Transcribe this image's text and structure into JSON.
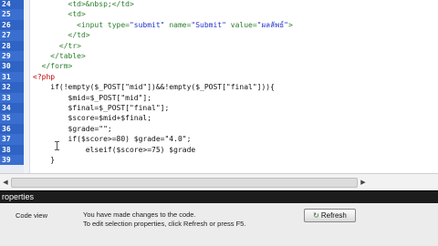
{
  "code_lines": [
    {
      "num": "24",
      "parts": [
        {
          "c": "tag",
          "t": "        <td>&nbsp;</td>"
        }
      ]
    },
    {
      "num": "25",
      "parts": [
        {
          "c": "tag",
          "t": "        <td>"
        }
      ]
    },
    {
      "num": "26",
      "parts": [
        {
          "c": "tag",
          "t": "          <input type="
        },
        {
          "c": "str",
          "t": "\"submit\""
        },
        {
          "c": "tag",
          "t": " name="
        },
        {
          "c": "str",
          "t": "\"Submit\""
        },
        {
          "c": "tag",
          "t": " value="
        },
        {
          "c": "str",
          "t": "\"ผลลัพธ์\""
        },
        {
          "c": "tag",
          "t": ">"
        }
      ]
    },
    {
      "num": "27",
      "parts": [
        {
          "c": "tag",
          "t": "        </td>"
        }
      ]
    },
    {
      "num": "28",
      "parts": [
        {
          "c": "tag",
          "t": "      </tr>"
        }
      ]
    },
    {
      "num": "29",
      "parts": [
        {
          "c": "tag",
          "t": "    </table>"
        }
      ]
    },
    {
      "num": "30",
      "parts": [
        {
          "c": "tag",
          "t": "  </form>"
        }
      ]
    },
    {
      "num": "31",
      "parts": [
        {
          "c": "php",
          "t": "<?php"
        }
      ]
    },
    {
      "num": "32",
      "parts": [
        {
          "c": "plain",
          "t": "    if(!empty($_POST[\"mid\"])&&!empty($_POST[\"final\"])){"
        }
      ]
    },
    {
      "num": "33",
      "parts": [
        {
          "c": "plain",
          "t": "        $mid=$_POST[\"mid\"];"
        }
      ]
    },
    {
      "num": "34",
      "parts": [
        {
          "c": "plain",
          "t": "        $final=$_POST[\"final\"];"
        }
      ]
    },
    {
      "num": "35",
      "parts": [
        {
          "c": "plain",
          "t": "        $score=$mid+$final;"
        }
      ]
    },
    {
      "num": "36",
      "parts": [
        {
          "c": "plain",
          "t": "        $grade=\"\";"
        }
      ]
    },
    {
      "num": "37",
      "parts": [
        {
          "c": "plain",
          "t": "        if($score>=80) $grade=\"4.0\";"
        }
      ]
    },
    {
      "num": "38",
      "parts": [
        {
          "c": "plain",
          "t": "            elseif($score>=75) $grade"
        }
      ]
    },
    {
      "num": "39",
      "parts": [
        {
          "c": "plain",
          "t": "    }"
        }
      ]
    }
  ],
  "properties_panel": {
    "title": "roperties",
    "code_view_label": "Code view",
    "message_line1": "You have made changes to the code.",
    "message_line2": "To edit selection properties, click Refresh or press F5.",
    "refresh_label": "Refresh"
  },
  "colors": {
    "line_number_bg": "#2f63c4",
    "tag_color": "#2b7d2b",
    "string_color": "#2233cc",
    "php_color": "#c00000"
  }
}
